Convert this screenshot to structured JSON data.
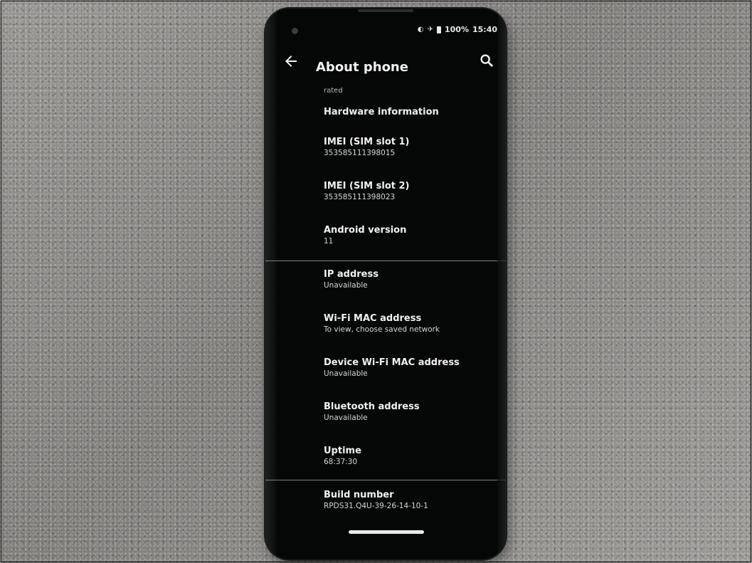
{
  "status_bar": {
    "battery": "100%",
    "time": "15:40",
    "icons": [
      "data-saver-icon",
      "airplane-icon",
      "battery-icon"
    ]
  },
  "app_bar": {
    "title": "About phone",
    "back_icon": "back-arrow-icon",
    "search_icon": "search-icon"
  },
  "partial_text": "rated",
  "section_header": "Hardware information",
  "items": [
    {
      "title": "IMEI (SIM slot 1)",
      "value": "353585111398015"
    },
    {
      "title": "IMEI (SIM slot 2)",
      "value": "353585111398023"
    },
    {
      "title": "Android version",
      "value": "11"
    },
    {
      "title": "IP address",
      "value": "Unavailable"
    },
    {
      "title": "Wi-Fi MAC address",
      "value": "To view, choose saved network"
    },
    {
      "title": "Device Wi-Fi MAC address",
      "value": "Unavailable"
    },
    {
      "title": "Bluetooth address",
      "value": "Unavailable"
    },
    {
      "title": "Uptime",
      "value": "68:37:30"
    },
    {
      "title": "Build number",
      "value": "RPDS31.Q4U-39-26-14-10-1"
    }
  ],
  "colors": {
    "screen_background": "#050706",
    "text_primary": "#f2f2f2",
    "text_secondary": "#d6d6d6",
    "surface_background": "#8c8b88"
  }
}
